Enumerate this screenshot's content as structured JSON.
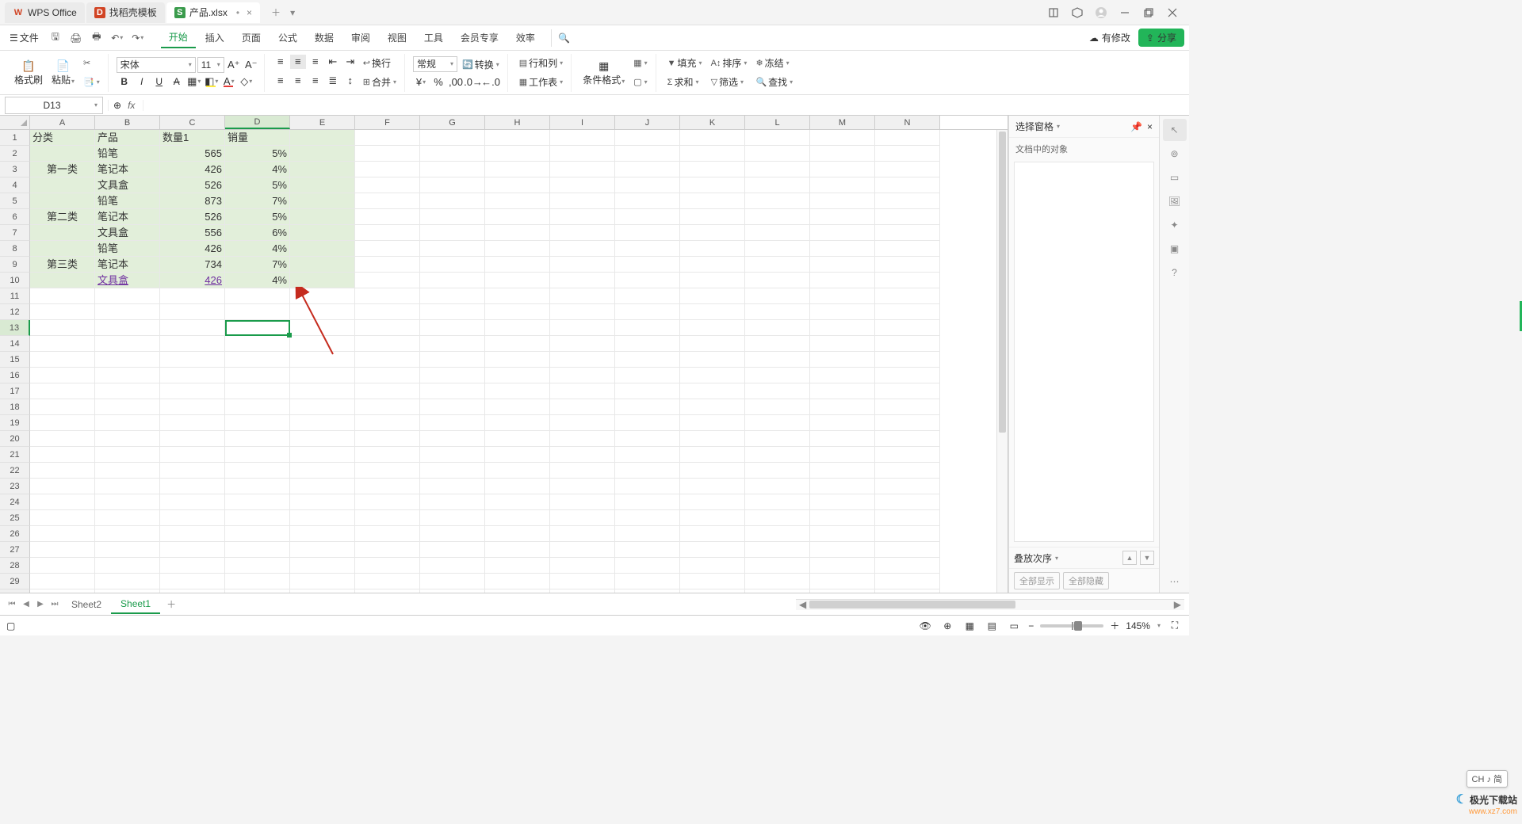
{
  "titlebar": {
    "app_name": "WPS Office",
    "tabs": [
      {
        "icon": "D",
        "label": "找稻壳模板"
      },
      {
        "icon": "S",
        "label": "产品.xlsx",
        "active": true,
        "dirty": "•"
      }
    ]
  },
  "menubar": {
    "file": "文件",
    "tabs": [
      "开始",
      "插入",
      "页面",
      "公式",
      "数据",
      "审阅",
      "视图",
      "工具",
      "会员专享",
      "效率"
    ],
    "active": 0,
    "cloud_status": "有修改",
    "share": "分享"
  },
  "ribbon": {
    "format_painter": "格式刷",
    "paste": "粘贴",
    "font_name": "宋体",
    "font_size": "11",
    "wrap": "换行",
    "merge": "合并",
    "numfmt": "常规",
    "convert": "转换",
    "rowscols": "行和列",
    "worksheet": "工作表",
    "cond_fmt": "条件格式",
    "fill": "填充",
    "sort": "排序",
    "freeze": "冻结",
    "sum": "求和",
    "filter": "筛选",
    "find": "查找"
  },
  "formulabar": {
    "name": "D13",
    "fx": "fx",
    "zoom": "⊕"
  },
  "columns": [
    "A",
    "B",
    "C",
    "D",
    "E",
    "F",
    "G",
    "H",
    "I",
    "J",
    "K",
    "L",
    "M",
    "N"
  ],
  "active_col": 3,
  "rows": 30,
  "active_row": 13,
  "data": {
    "headers": [
      "分类",
      "产品",
      "数量1",
      "销量"
    ],
    "body": [
      {
        "cat": "",
        "prod": "铅笔",
        "qty": "565",
        "sale": "5%"
      },
      {
        "cat": "第一类",
        "prod": "笔记本",
        "qty": "426",
        "sale": "4%"
      },
      {
        "cat": "",
        "prod": "文具盒",
        "qty": "526",
        "sale": "5%"
      },
      {
        "cat": "",
        "prod": "铅笔",
        "qty": "873",
        "sale": "7%"
      },
      {
        "cat": "第二类",
        "prod": "笔记本",
        "qty": "526",
        "sale": "5%"
      },
      {
        "cat": "",
        "prod": "文具盒",
        "qty": "556",
        "sale": "6%"
      },
      {
        "cat": "",
        "prod": "铅笔",
        "qty": "426",
        "sale": "4%"
      },
      {
        "cat": "第三类",
        "prod": "笔记本",
        "qty": "734",
        "sale": "7%"
      },
      {
        "cat": "",
        "prod": "文具盒",
        "qty": "426",
        "sale": "4%",
        "link": true
      }
    ]
  },
  "sheets": {
    "items": [
      "Sheet2",
      "Sheet1"
    ],
    "active": 1
  },
  "taskpane": {
    "title": "选择窗格",
    "sub": "文档中的对象",
    "order": "叠放次序",
    "show_all": "全部显示",
    "hide_all": "全部隐藏"
  },
  "statusbar": {
    "zoom": "145%"
  },
  "ime": "CH ♪ 简",
  "watermark": {
    "name": "极光下载站",
    "url": "www.xz7.com"
  }
}
